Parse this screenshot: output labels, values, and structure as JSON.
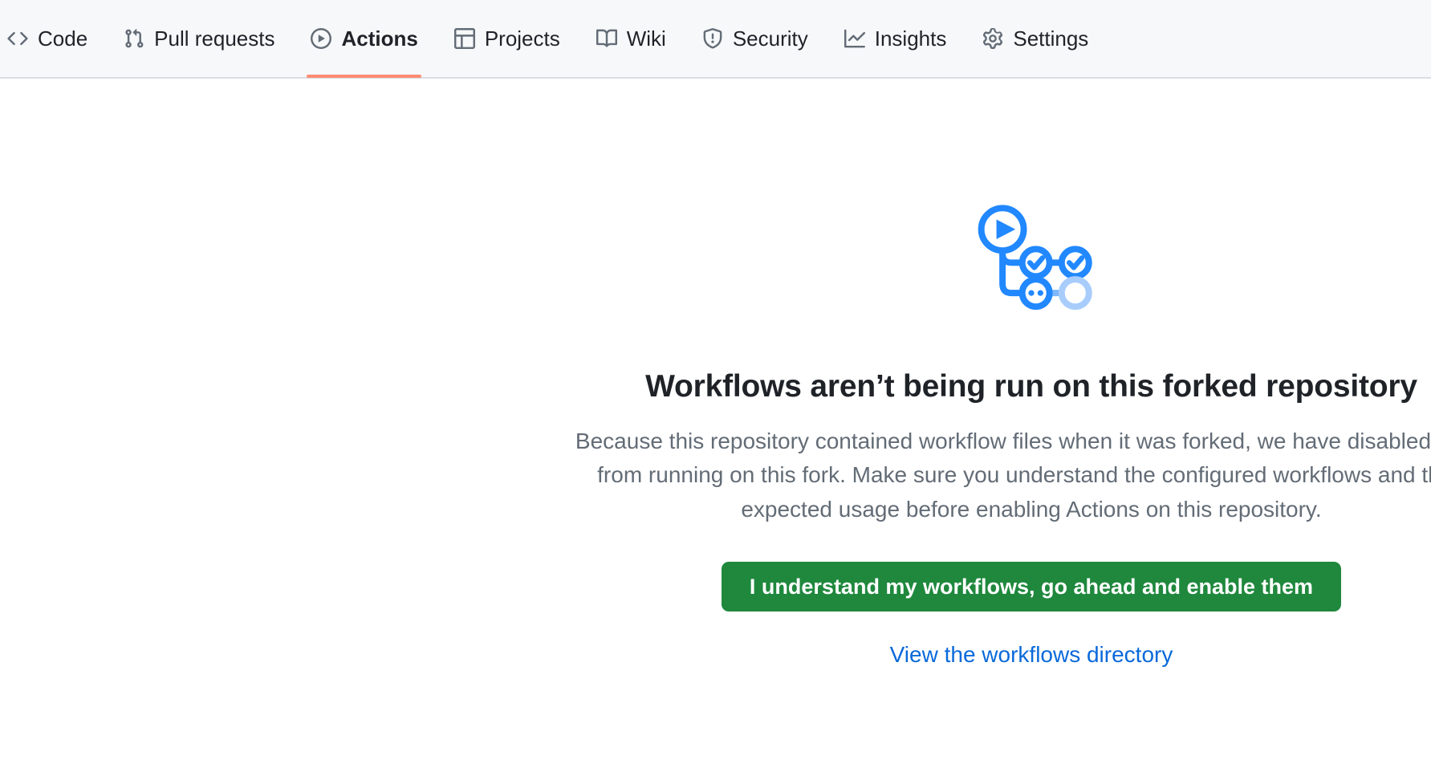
{
  "repo_nav": {
    "items": [
      {
        "label": "Code",
        "icon": "code-icon",
        "selected": false
      },
      {
        "label": "Pull requests",
        "icon": "git-pull-request-icon",
        "selected": false
      },
      {
        "label": "Actions",
        "icon": "play-icon",
        "selected": true
      },
      {
        "label": "Projects",
        "icon": "table-icon",
        "selected": false
      },
      {
        "label": "Wiki",
        "icon": "book-icon",
        "selected": false
      },
      {
        "label": "Security",
        "icon": "shield-icon",
        "selected": false
      },
      {
        "label": "Insights",
        "icon": "graph-icon",
        "selected": false
      },
      {
        "label": "Settings",
        "icon": "gear-icon",
        "selected": false
      }
    ],
    "selected_underline_color": "#fd8c73",
    "background_color": "#f6f8fa"
  },
  "blankslate": {
    "illustration_name": "actions-workflow-illustration",
    "illustration_color": "#2188ff",
    "heading": "Workflows aren’t being run on this forked repository",
    "description": "Because this repository contained workflow files when it was forked, we have disabled them from running on this fork. Make sure you understand the configured workflows and their expected usage before enabling Actions on this repository.",
    "enable_button_label": "I understand my workflows, go ahead and enable them",
    "enable_button_color": "#1f883d",
    "workflows_link_label": "View the workflows directory",
    "workflows_link_color": "#0969da"
  }
}
